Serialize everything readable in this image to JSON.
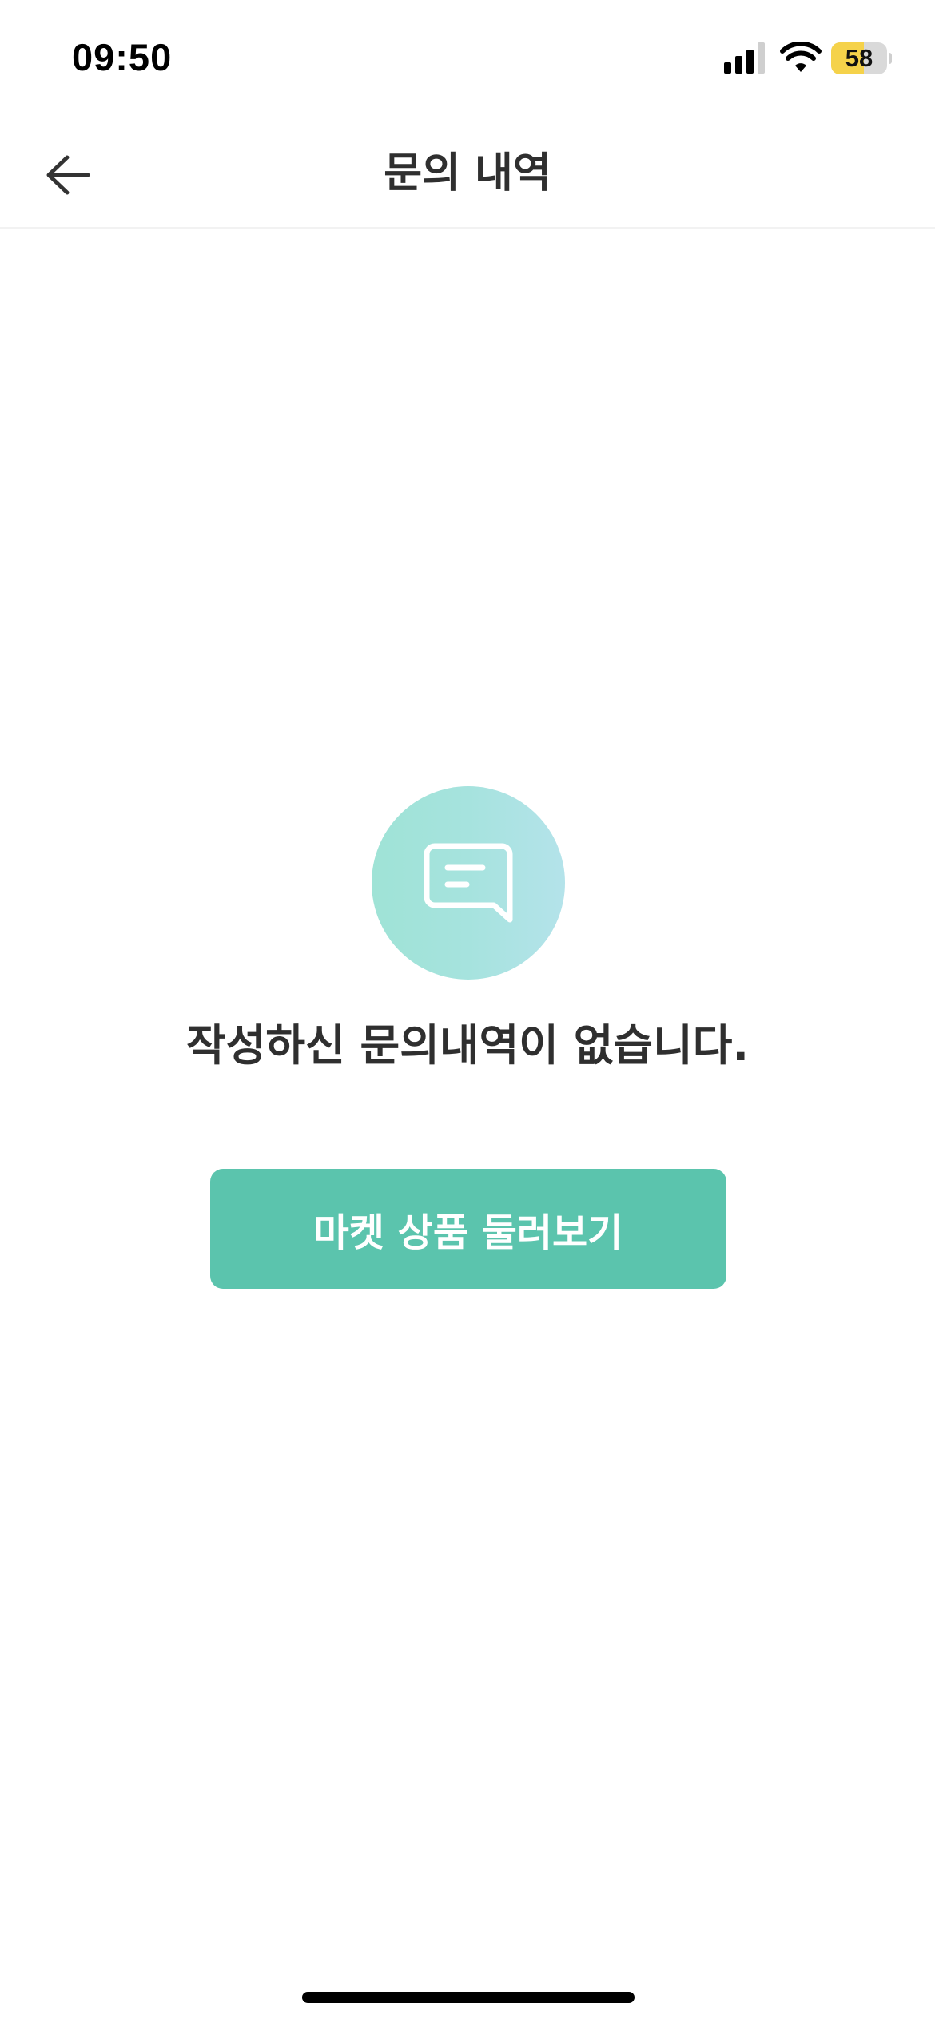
{
  "status_bar": {
    "time": "09:50",
    "battery_level": "58",
    "battery_fraction": 0.58,
    "battery_color": "#f5d24a",
    "icons": [
      "cellular-signal-icon",
      "wifi-icon",
      "battery-icon"
    ]
  },
  "header": {
    "title": "문의 내역",
    "back_icon": "arrow-left-icon"
  },
  "empty_state": {
    "icon": "chat-bubble-icon",
    "message": "작성하신 문의내역이 없습니다."
  },
  "cta": {
    "label": "마켓 상품 둘러보기",
    "color": "#5bc4ad"
  }
}
